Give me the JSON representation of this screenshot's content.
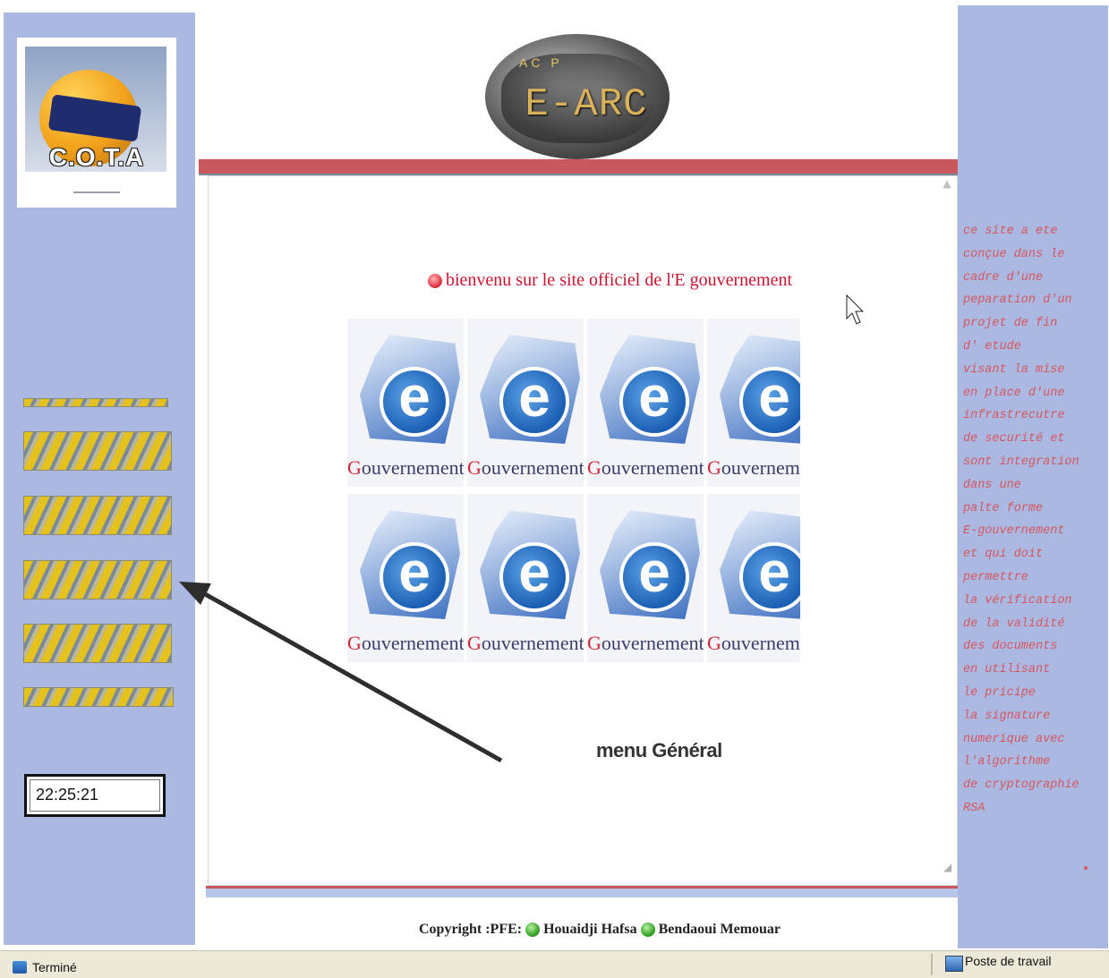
{
  "logo": {
    "text": "C.O.T.A"
  },
  "banner": {
    "small_text": "AC P",
    "title": "E-ARC"
  },
  "welcome": {
    "text": "bienvenu sur le site officiel de l'E gouvernement"
  },
  "tiles": {
    "letter": "e",
    "labels": [
      "Gouvernement",
      "Gouvernement",
      "Gouvernement",
      "Gouvernem",
      "Gouvernement",
      "Gouvernement",
      "Gouvernement",
      "Gouvernem"
    ]
  },
  "menu_label": "menu Général",
  "clock": {
    "time": "22:25:21"
  },
  "copyright": {
    "prefix": "Copyright :PFE:",
    "author1": "Houaidji Hafsa",
    "author2": "Bendaoui Memouar"
  },
  "side_text": [
    "ce site a ete",
    "conçue dans le",
    "cadre d'une",
    "peparation d'un",
    "projet de fin",
    "d' etude",
    "visant la mise",
    "en place d'une",
    "infrastrecutre",
    "de securité et",
    "sont integration",
    "dans une",
    "palte forme",
    "E-gouvernement",
    "et qui doit",
    "permettre",
    "la vérification",
    "de la validité",
    "des documents",
    "en utilisant",
    "le pricipe",
    "la signature",
    "numerique avec",
    "l'algorithme",
    "de cryptographie",
    "RSA"
  ],
  "statusbar": {
    "left_text": "Terminé",
    "right_text": "Poste de travail"
  },
  "colors": {
    "sidebar": "#aab8e2",
    "accent_red": "#c9585e",
    "side_text": "#d6575e"
  }
}
